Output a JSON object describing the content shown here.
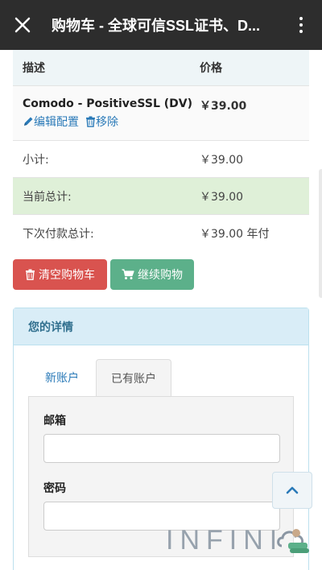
{
  "topbar": {
    "title": "购物车 - 全球可信SSL证书、D...",
    "close_icon": "close-icon",
    "more_icon": "more-vertical-icon"
  },
  "cart": {
    "header": {
      "desc": "描述",
      "price": "价格"
    },
    "item": {
      "name": "Comodo - PositiveSSL (DV)",
      "edit_label": "编辑配置",
      "remove_label": "移除",
      "price": "￥39.00"
    },
    "subtotal": {
      "label": "小计:",
      "value": "￥39.00"
    },
    "total_now": {
      "label": "当前总计:",
      "value": "￥39.00"
    },
    "next_total": {
      "label": "下次付款总计:",
      "value": "￥39.00 年付"
    }
  },
  "buttons": {
    "empty_cart": "清空购物车",
    "continue_shopping": "继续购物"
  },
  "details": {
    "title": "您的详情",
    "tabs": {
      "new_account": "新账户",
      "existing_account": "已有账户"
    },
    "email_label": "邮箱",
    "password_label": "密码"
  },
  "watermark": "INFINI",
  "colors": {
    "topbar": "#2d2d2d",
    "link": "#2a7ab8",
    "danger": "#d9534f",
    "success": "#5cb08a",
    "highlight_row": "#dff0d8",
    "panel_header": "#d9edf7"
  }
}
